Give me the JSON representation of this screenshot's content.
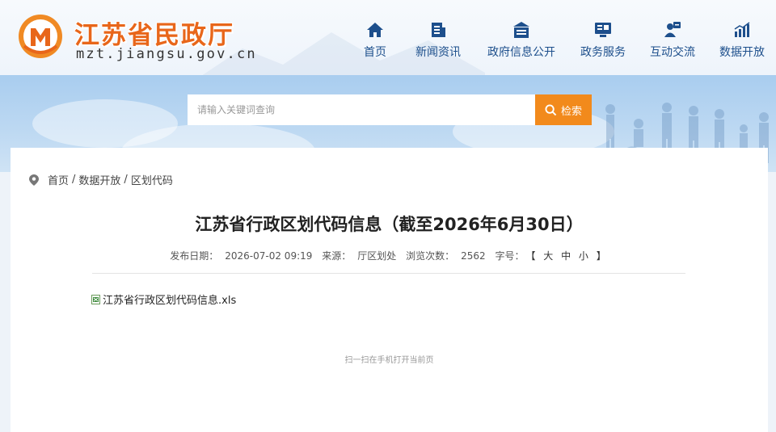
{
  "site": {
    "name": "江苏省民政厅",
    "domain": "mzt.jiangsu.gov.cn"
  },
  "nav": [
    {
      "label": "首页",
      "icon": "home-icon"
    },
    {
      "label": "新闻资讯",
      "icon": "news-icon"
    },
    {
      "label": "政府信息公开",
      "icon": "info-disclosure-icon"
    },
    {
      "label": "政务服务",
      "icon": "service-icon"
    },
    {
      "label": "互动交流",
      "icon": "interaction-icon"
    },
    {
      "label": "数据开放",
      "icon": "data-chart-icon"
    }
  ],
  "search": {
    "placeholder": "请输入关键词查询",
    "button_label": "检索"
  },
  "breadcrumb": {
    "items": [
      "首页",
      "数据开放",
      "区划代码"
    ],
    "separator": "/"
  },
  "article": {
    "title": "江苏省行政区划代码信息（截至2026年6月30日）",
    "publish_label": "发布日期：",
    "publish_date": "2026-07-02 09:19",
    "source_label": "来源：",
    "source": "厅区划处",
    "views_label": "浏览次数：",
    "views": "2562",
    "fontsize_label": "字号：",
    "fontsize_options": "【 大 中 小 】",
    "attachment": "江苏省行政区划代码信息.xls",
    "qr_hint": "扫一扫在手机打开当前页"
  },
  "colors": {
    "brand_orange": "#e8661a",
    "nav_blue": "#1d4f8c",
    "search_button": "#f28a1c"
  }
}
